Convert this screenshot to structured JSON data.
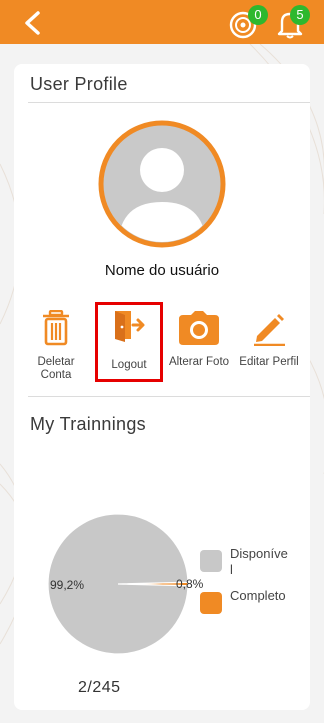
{
  "header": {
    "back_icon": "chevron-left-icon",
    "achievements_badge": "0",
    "notifications_badge": "5",
    "accent_color": "#f08a24",
    "badge_color": "#2eb82e"
  },
  "profile": {
    "title": "User Profile",
    "username": "Nome do usuário",
    "avatar_icon": "user-avatar-icon"
  },
  "actions": [
    {
      "label": "Deletar Conta",
      "icon": "trash-icon"
    },
    {
      "label": "Logout",
      "icon": "logout-icon"
    },
    {
      "label": "Alterar Foto",
      "icon": "camera-icon"
    },
    {
      "label": "Editar Perfil",
      "icon": "pencil-icon"
    }
  ],
  "trainings": {
    "title": "My Trainnings",
    "count_text": "2/245"
  },
  "chart_data": {
    "type": "pie",
    "slices": [
      {
        "name": "Disponível",
        "value": 99.2,
        "label": "99,2%",
        "color": "#c8c8c8"
      },
      {
        "name": "Completo",
        "value": 0.8,
        "label": "0,8%",
        "color": "#f08a24"
      }
    ],
    "legend": [
      "Disponível",
      "Completo"
    ],
    "legend_placement": "right"
  }
}
